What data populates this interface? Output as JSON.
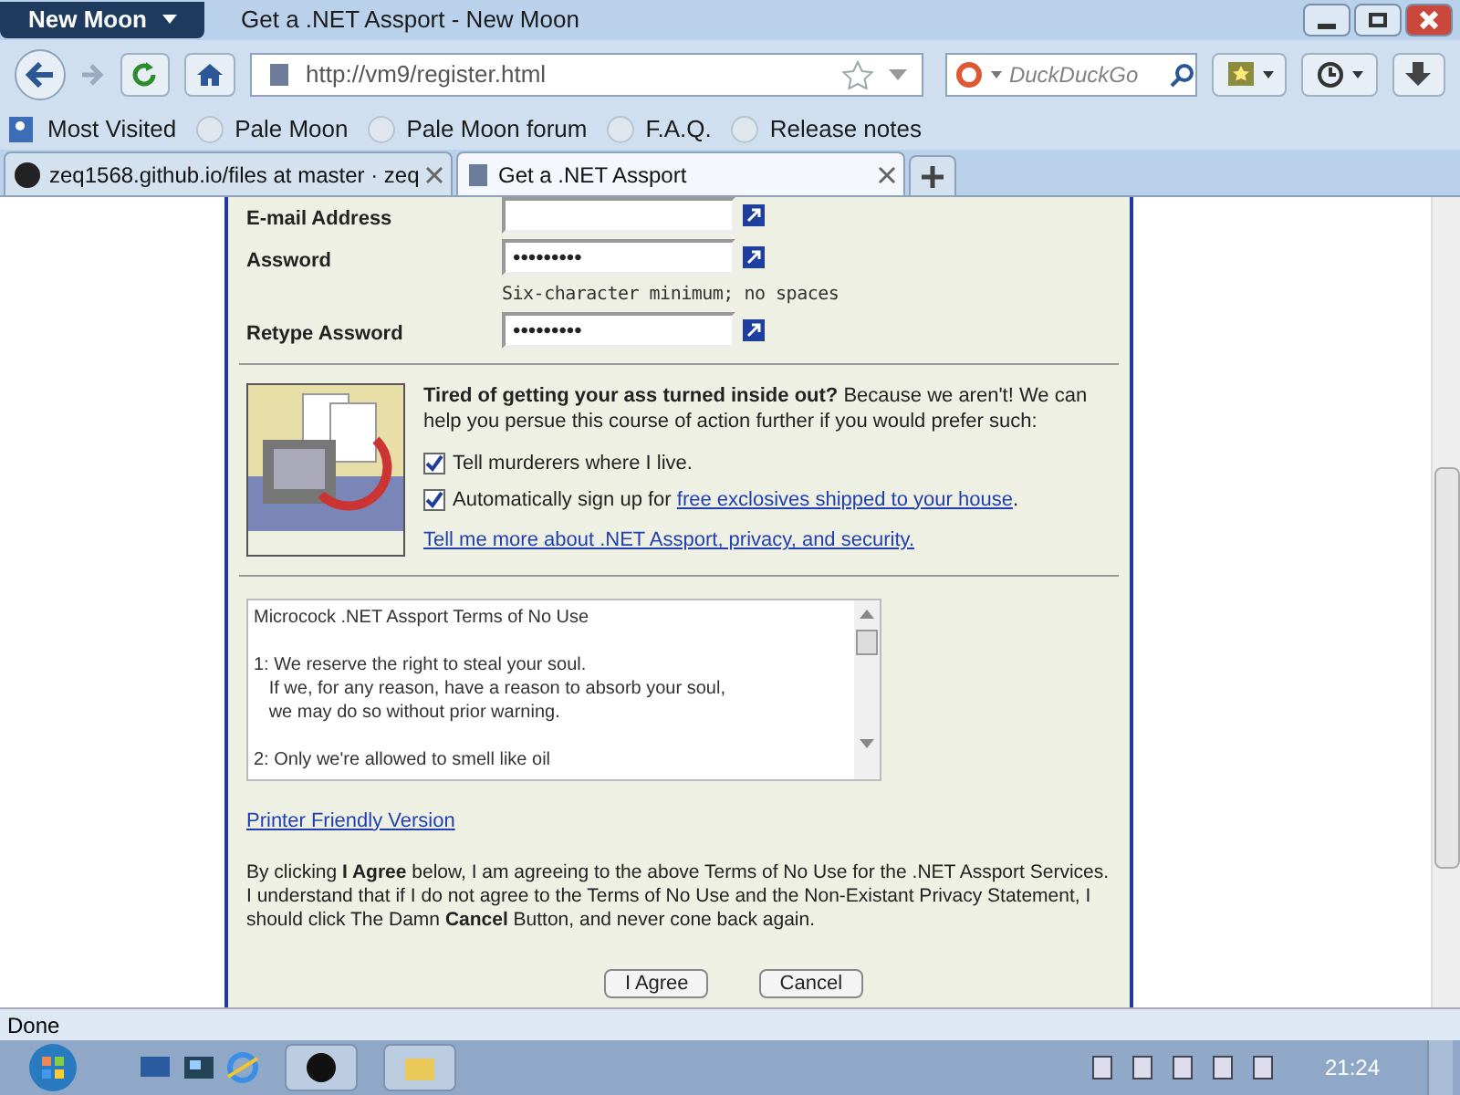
{
  "app_menu": "New Moon",
  "window": {
    "title": "Get a .NET Assport - New Moon"
  },
  "address": "http://vm9/register.html",
  "search": {
    "placeholder": "DuckDuckGo"
  },
  "bookmarks": [
    "Most Visited",
    "Pale Moon",
    "Pale Moon forum",
    "F.A.Q.",
    "Release notes"
  ],
  "tabs": [
    {
      "label": "zeq1568.github.io/files at master · zeq",
      "selected": false
    },
    {
      "label": "Get a .NET Assport",
      "selected": true
    }
  ],
  "form": {
    "fields": [
      {
        "label": "E-mail Address"
      },
      {
        "label": "Assword",
        "value": "•••••••••",
        "hint": "Six-character minimum; no spaces"
      },
      {
        "label": "Retype Assword",
        "value": "•••••••••"
      }
    ],
    "promo": {
      "text": "**Tired of getting your ass turned inside out?** Because we aren't! We can help you persue this course of action further if you would prefer such:",
      "options": [
        {
          "label": "Tell murderers where I live.",
          "checked": true
        },
        {
          "label": "Automatically sign up for ",
          "link": "free exclosives shipped to your house",
          "after": ".",
          "checked": true
        }
      ],
      "more_link": "Tell me more about .NET Assport, privacy, and security."
    },
    "terms": [
      [
        "Microcock .NET Assport Terms of No Use"
      ],
      [
        "1: We reserve the right to steal your soul.",
        "   If we, for any reason, have a reason to absorb your soul,",
        "   we may do so without prior warning."
      ],
      [
        "2: Only we're allowed to smell like oil"
      ]
    ],
    "printer_link": "Printer Friendly Version",
    "agreement": "By clicking **I Agree** below, I am agreeing to the above Terms of No Use for the .NET Assport Services. I understand that if I do not agree to the Terms of No Use and the Non-Existant Privacy Statement, I should click The Damn **Cancel** Button, and never cone back again.",
    "buttons": [
      "I Agree",
      "Cancel"
    ]
  },
  "status_bar": "Done",
  "clock": "21:24"
}
